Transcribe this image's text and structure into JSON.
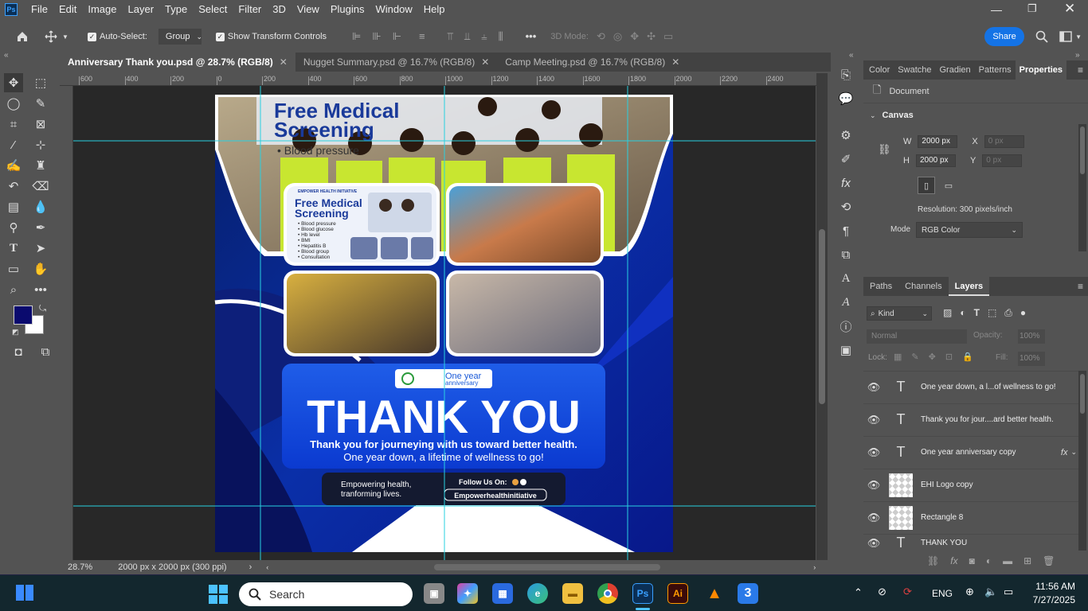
{
  "app": {
    "logo": "Ps"
  },
  "menu": [
    "File",
    "Edit",
    "Image",
    "Layer",
    "Type",
    "Select",
    "Filter",
    "3D",
    "View",
    "Plugins",
    "Window",
    "Help"
  ],
  "options": {
    "auto_select_label": "Auto-Select:",
    "auto_select_value": "Group",
    "show_transform_label": "Show Transform Controls",
    "mode_3d_label": "3D Mode:",
    "share_label": "Share"
  },
  "tabs": [
    {
      "label": "Anniversary Thank you.psd @ 28.7% (RGB/8)",
      "active": true
    },
    {
      "label": "Nugget Summary.psd @ 16.7% (RGB/8)",
      "active": false
    },
    {
      "label": "Camp Meeting.psd @ 16.7% (RGB/8)",
      "active": false
    }
  ],
  "ruler_h": [
    "600",
    "400",
    "200",
    "0",
    "200",
    "400",
    "600",
    "800",
    "1000",
    "1200",
    "1400",
    "1600",
    "1800",
    "2000",
    "2200",
    "2400"
  ],
  "colors": {
    "foreground": "#0a0a6e",
    "background": "#ffffff",
    "accent": "#1473e6"
  },
  "artwork": {
    "top_heading_line1": "Free Medical",
    "top_heading_line2": "Screening",
    "top_bullet": "• Blood pressure",
    "card_brand": "EMPOWER HEALTH INITIATIVE",
    "card_title_1": "Free Medical",
    "card_title_2": "Screening",
    "card_items": [
      "• Blood pressure",
      "• Blood glucose",
      "• Hb level",
      "• BMI",
      "• Hepatitis B",
      "• Blood group",
      "• Consultation"
    ],
    "badge_line1": "One year",
    "badge_line2": "anniversary",
    "thank_you": "THANK YOU",
    "line1": "Thank you for journeying with us toward better health.",
    "line2": "One year down, a lifetime of wellness to go!",
    "slogan_line1": "Empowering health,",
    "slogan_line2": "tranforming lives.",
    "follow": "Follow Us On:",
    "handle": "Empowerhealthinitiative"
  },
  "status": {
    "zoom": "28.7%",
    "doc_size": "2000 px x 2000 px (300 ppi)"
  },
  "properties": {
    "tabs": [
      "Color",
      "Swatche",
      "Gradien",
      "Patterns",
      "Properties"
    ],
    "active_tab": "Properties",
    "document_label": "Document",
    "canvas_label": "Canvas",
    "w_label": "W",
    "w_value": "2000 px",
    "h_label": "H",
    "h_value": "2000 px",
    "x_label": "X",
    "x_placeholder": "0 px",
    "y_label": "Y",
    "y_placeholder": "0 px",
    "resolution": "Resolution: 300 pixels/inch",
    "mode_label": "Mode",
    "mode_value": "RGB Color"
  },
  "layers": {
    "tabs": [
      "Paths",
      "Channels",
      "Layers"
    ],
    "active_tab": "Layers",
    "filter_kind": "Kind",
    "blend_mode": "Normal",
    "opacity_label": "Opacity:",
    "opacity_value": "100%",
    "lock_label": "Lock:",
    "fill_label": "Fill:",
    "fill_value": "100%",
    "items": [
      {
        "name": "One year down, a l...of wellness to go!",
        "type": "text",
        "fx": false
      },
      {
        "name": "Thank you for jour....ard better health.",
        "type": "text",
        "fx": false
      },
      {
        "name": "One year anniversary copy",
        "type": "text",
        "fx": true
      },
      {
        "name": "EHI Logo copy",
        "type": "smart",
        "fx": false
      },
      {
        "name": "Rectangle 8",
        "type": "shape",
        "fx": false
      },
      {
        "name": "THANK YOU",
        "type": "text",
        "fx": false
      }
    ]
  },
  "taskbar": {
    "search_label": "Search",
    "language": "ENG",
    "time": "11:56 AM",
    "date": "7/27/2025"
  }
}
